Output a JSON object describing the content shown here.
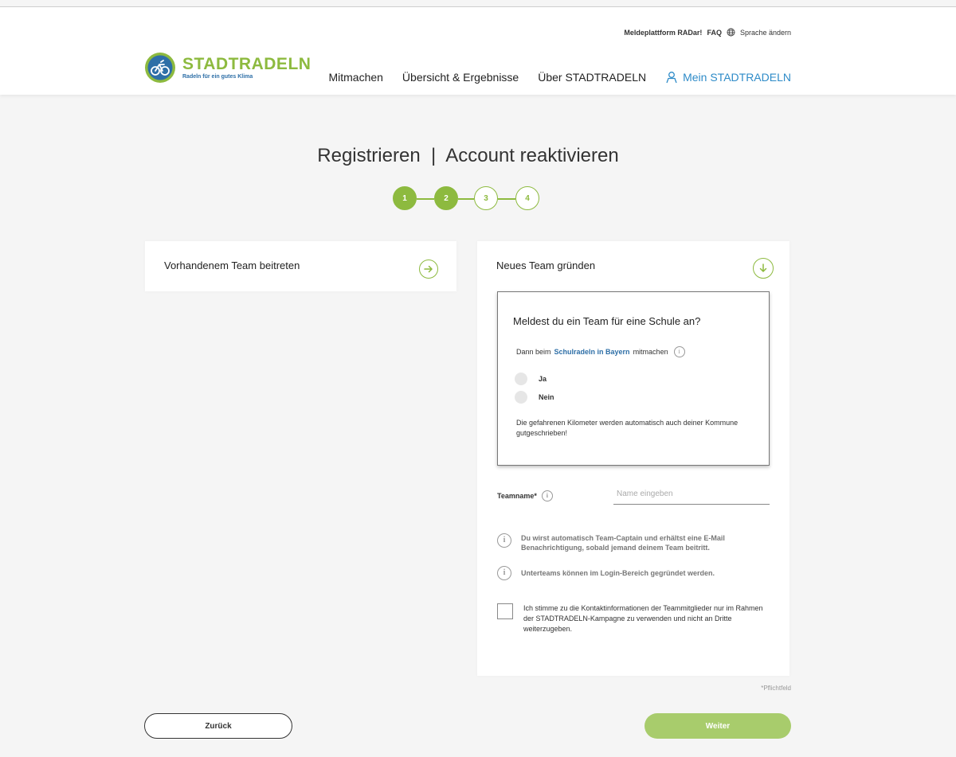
{
  "header": {
    "meta_links": {
      "reporting_platform": "Meldeplattform RADar!",
      "faq": "FAQ",
      "language": "Sprache ändern"
    },
    "logo": {
      "name": "STADTRADELN",
      "claim": "Radeln für ein gutes Klima"
    },
    "nav": {
      "participate": "Mitmachen",
      "overview": "Übersicht & Ergebnisse",
      "about": "Über STADTRADELN",
      "account": "Mein STADTRADELN"
    },
    "colors": {
      "brand_green": "#8dba3f",
      "brand_blue": "#2e6fa7",
      "link_blue": "#2e8bc8"
    }
  },
  "page": {
    "title": "Registrieren  |  Account reaktivieren",
    "steps": [
      {
        "label": "1",
        "state": "done"
      },
      {
        "label": "2",
        "state": "done"
      },
      {
        "label": "3",
        "state": "open"
      },
      {
        "label": "4",
        "state": "open"
      }
    ]
  },
  "join_team": {
    "title": "Vorhandenem Team beitreten",
    "icon": "arrow-right-circle-icon"
  },
  "new_team": {
    "title": "Neues Team gründen",
    "icon": "arrow-down-circle-icon",
    "school": {
      "question": "Meldest du ein Team für eine Schule an?",
      "sub_prefix": "Dann beim",
      "sub_link": "Schulradeln in Bayern",
      "sub_suffix": "mitmachen",
      "options": {
        "yes": "Ja",
        "no": "Nein"
      },
      "note": "Die gefahrenen Kilometer werden automatisch auch deiner Kommune gutgeschrieben!"
    },
    "team_name": {
      "label": "Teamname*",
      "placeholder": "Name eingeben",
      "value": ""
    },
    "hints": {
      "captain": "Du wirst automatisch Team-Captain und erhältst eine E-Mail Benachrichtigung, sobald jemand deinem Team beitritt.",
      "subteams": "Unterteams können im Login-Bereich gegründet werden."
    },
    "consent": "Ich stimme zu die Kontaktinformationen der Teammitglieder nur im Rahmen der STADTRADELN-Kampagne zu verwenden und nicht an Dritte weiterzugeben."
  },
  "footer": {
    "required_note": "*Pflichtfeld",
    "back": "Zurück",
    "next": "Weiter"
  }
}
